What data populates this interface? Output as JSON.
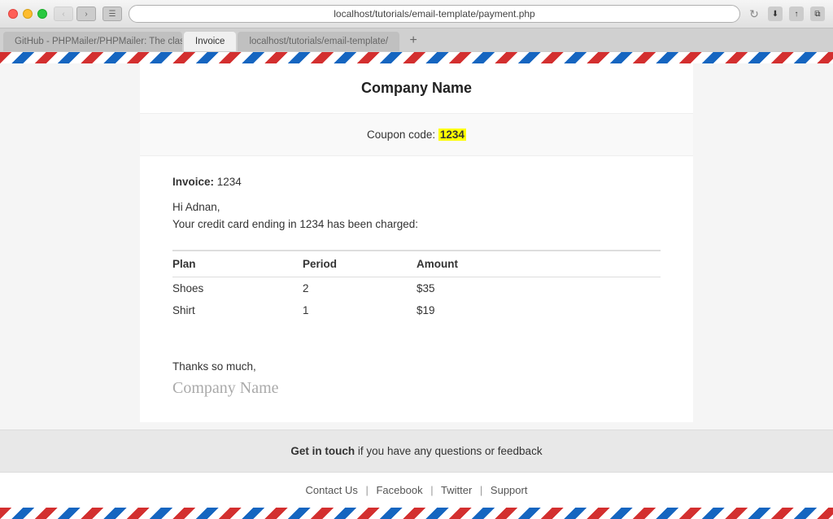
{
  "browser": {
    "url": "localhost/tutorials/email-template/payment.php",
    "reload_icon": "↻",
    "back_icon": "‹",
    "forward_icon": "›",
    "reader_icon": "☰",
    "share_icon": "↑",
    "plus_icon": "+"
  },
  "tabs": [
    {
      "label": "GitHub - PHPMailer/PHPMailer: The classic email sending library for PHP",
      "active": false
    },
    {
      "label": "Invoice",
      "active": true
    },
    {
      "label": "localhost/tutorials/email-template/",
      "active": false
    }
  ],
  "email": {
    "company_name": "Company Name",
    "coupon_label": "Coupon code:",
    "coupon_code": "1234",
    "invoice_label": "Invoice:",
    "invoice_number": "1234",
    "greeting": "Hi Adnan,",
    "charge_text": "Your credit card ending in 1234 has been charged:",
    "table": {
      "headers": [
        "Plan",
        "Period",
        "Amount"
      ],
      "rows": [
        {
          "plan": "Shoes",
          "period": "2",
          "amount": "$35"
        },
        {
          "plan": "Shirt",
          "period": "1",
          "amount": "$19"
        }
      ]
    },
    "thanks_text": "Thanks so much,",
    "signature": "Company Name",
    "footer": {
      "get_in_touch": "Get in touch",
      "footer_text": "if you have any questions or feedback",
      "links": [
        "Contact Us",
        "Facebook",
        "Twitter",
        "Support"
      ]
    }
  }
}
